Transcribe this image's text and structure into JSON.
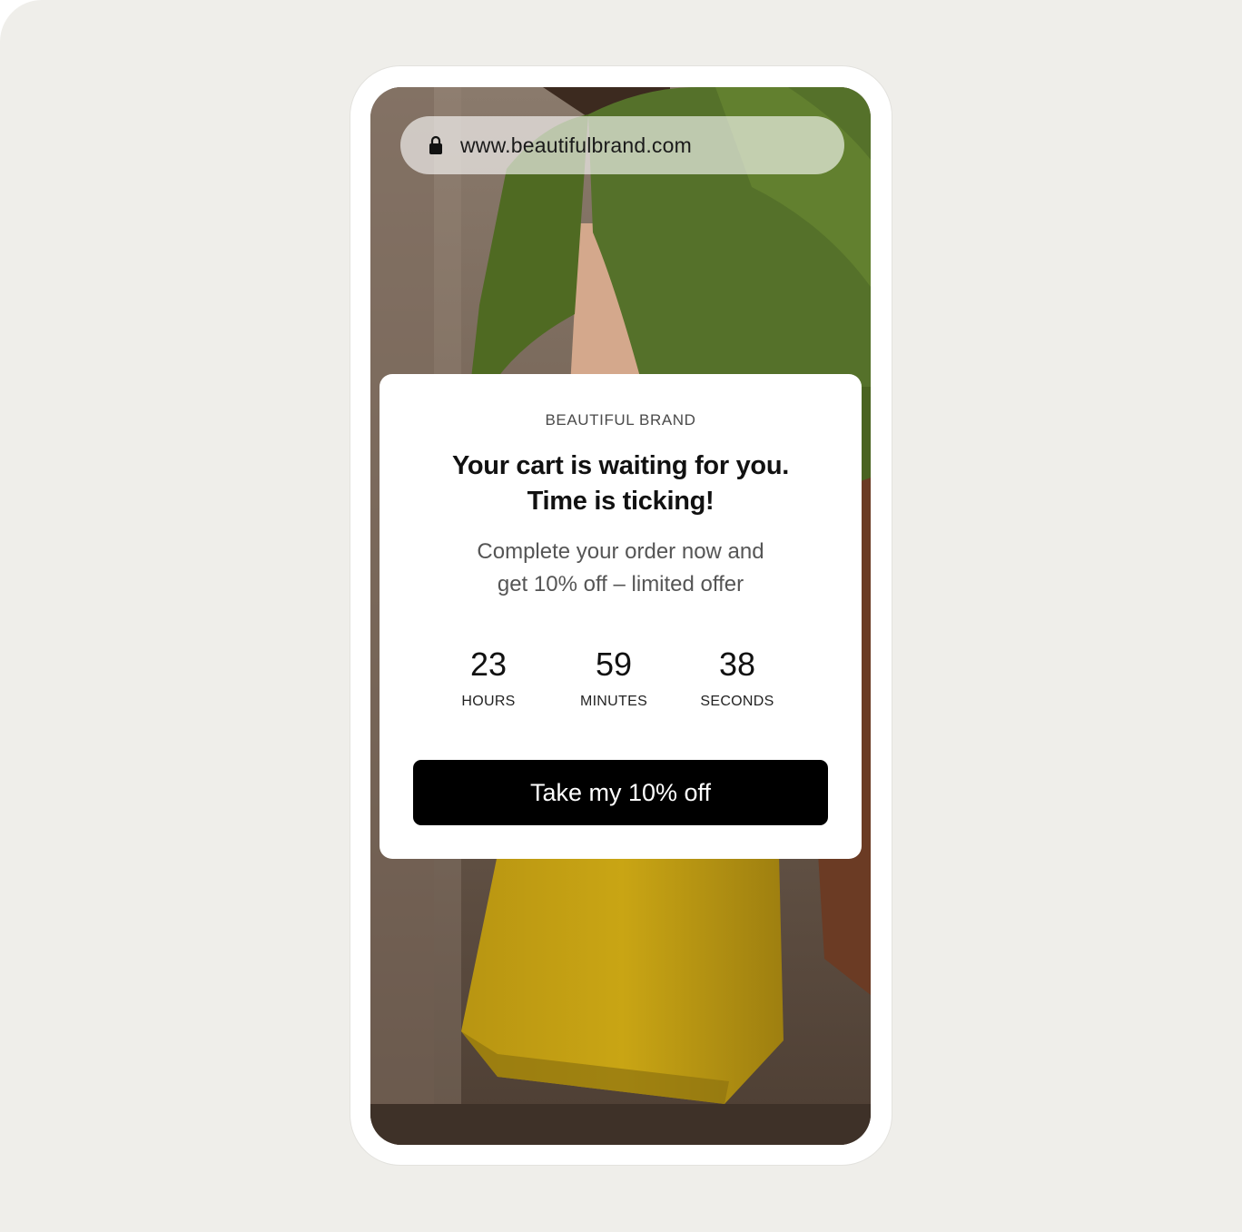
{
  "browser": {
    "url": "www.beautifulbrand.com",
    "lock_icon": "lock-icon"
  },
  "popup": {
    "brand": "BEAUTIFUL BRAND",
    "headline_line1": "Your cart is waiting for you.",
    "headline_line2": "Time is ticking!",
    "subtext_line1": "Complete your order now and",
    "subtext_line2": "get 10% off – limited offer",
    "countdown": {
      "hours": {
        "value": "23",
        "label": "HOURS"
      },
      "minutes": {
        "value": "59",
        "label": "MINUTES"
      },
      "seconds": {
        "value": "38",
        "label": "SECONDS"
      }
    },
    "cta_label": "Take my 10% off"
  },
  "colors": {
    "page_background": "#efeeea",
    "cta_background": "#000000",
    "cta_text": "#ffffff",
    "sweater_green": "#4f6a22",
    "bag_yellow": "#c9a514"
  }
}
